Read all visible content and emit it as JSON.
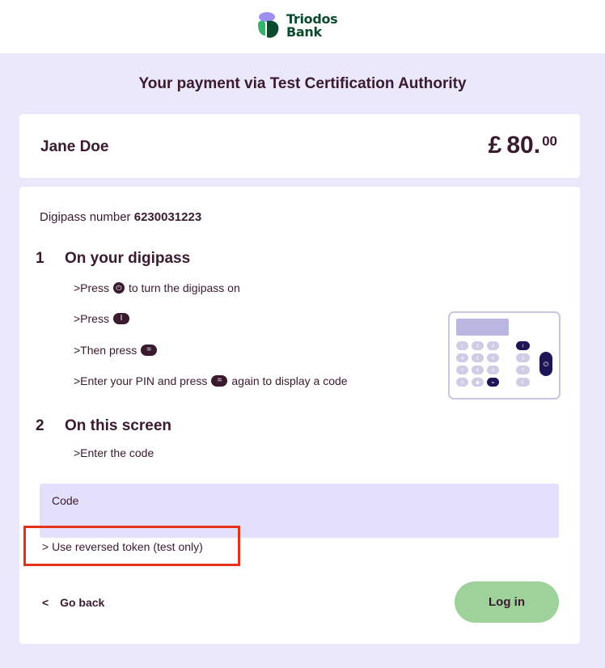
{
  "brand": {
    "logo_line1": "Triodos",
    "logo_line2": "Bank",
    "logo_color": "#0b4a2e",
    "accent_purple": "#9d8ef0",
    "accent_green": "#36b36b"
  },
  "header": {
    "title": "Your payment via Test Certification Authority"
  },
  "payment": {
    "payer": "Jane Doe",
    "currency": "£",
    "amount_main": "80.",
    "amount_cents": "00"
  },
  "digipass": {
    "label": "Digipass number",
    "number": "6230031223"
  },
  "steps": [
    {
      "num": "1",
      "title": "On your digipass",
      "instructions": [
        {
          "prefix": ">Press",
          "icon": "power-icon",
          "suffix": "to turn the digipass on"
        },
        {
          "prefix": ">Press",
          "icon": "i-key-icon",
          "suffix": ""
        },
        {
          "prefix": ">Then press",
          "icon": "equals-key-icon",
          "suffix": ""
        },
        {
          "prefix": ">Enter your PIN and press",
          "icon": "equals-key-icon",
          "suffix": "again to display a code"
        }
      ]
    },
    {
      "num": "2",
      "title": "On this screen",
      "instructions": [
        {
          "prefix": ">Enter the code",
          "icon": "",
          "suffix": ""
        }
      ]
    }
  ],
  "code_field": {
    "label": "Code",
    "value": ""
  },
  "reverse_link": "> Use reversed token (test only)",
  "back": {
    "arrow": "<",
    "label": "Go back"
  },
  "login": {
    "label": "Log in",
    "color": "#9ed29a"
  },
  "highlight_color": "#e8311a"
}
